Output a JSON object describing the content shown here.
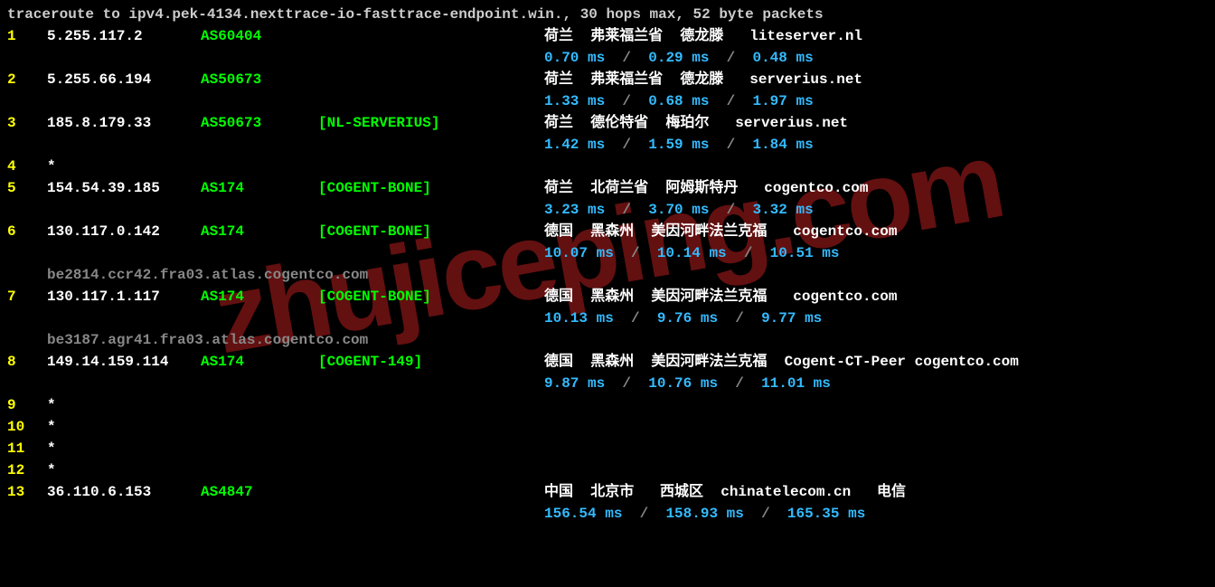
{
  "header": "traceroute to ipv4.pek-4134.nexttrace-io-fasttrace-endpoint.win., 30 hops max, 52 byte packets",
  "watermark": "zhujiceping.com",
  "hops": [
    {
      "num": "1",
      "ip": "5.255.117.2",
      "as": "AS60404",
      "tag": "",
      "loc": "荷兰  弗莱福兰省  德龙滕   liteserver.nl",
      "lat": [
        "0.70 ms",
        "0.29 ms",
        "0.48 ms"
      ]
    },
    {
      "num": "2",
      "ip": "5.255.66.194",
      "as": "AS50673",
      "tag": "",
      "loc": "荷兰  弗莱福兰省  德龙滕   serverius.net",
      "lat": [
        "1.33 ms",
        "0.68 ms",
        "1.97 ms"
      ]
    },
    {
      "num": "3",
      "ip": "185.8.179.33",
      "as": "AS50673",
      "tag": "[NL-SERVERIUS]",
      "loc": "荷兰  德伦特省  梅珀尔   serverius.net",
      "lat": [
        "1.42 ms",
        "1.59 ms",
        "1.84 ms"
      ]
    },
    {
      "num": "4",
      "ip": "*",
      "as": "",
      "tag": "",
      "loc": "",
      "lat": []
    },
    {
      "num": "5",
      "ip": "154.54.39.185",
      "as": "AS174",
      "tag": "[COGENT-BONE]",
      "loc": "荷兰  北荷兰省  阿姆斯特丹   cogentco.com",
      "lat": [
        "3.23 ms",
        "3.70 ms",
        "3.32 ms"
      ]
    },
    {
      "num": "6",
      "ip": "130.117.0.142",
      "as": "AS174",
      "tag": "[COGENT-BONE]",
      "loc": "德国  黑森州  美因河畔法兰克福   cogentco.com",
      "lat": [
        "10.07 ms",
        "10.14 ms",
        "10.51 ms"
      ],
      "rdns": "be2814.ccr42.fra03.atlas.cogentco.com"
    },
    {
      "num": "7",
      "ip": "130.117.1.117",
      "as": "AS174",
      "tag": "[COGENT-BONE]",
      "loc": "德国  黑森州  美因河畔法兰克福   cogentco.com",
      "lat": [
        "10.13 ms",
        "9.76 ms",
        "9.77 ms"
      ],
      "rdns": "be3187.agr41.fra03.atlas.cogentco.com"
    },
    {
      "num": "8",
      "ip": "149.14.159.114",
      "as": "AS174",
      "tag": "[COGENT-149]",
      "loc": "德国  黑森州  美因河畔法兰克福  Cogent-CT-Peer cogentco.com",
      "lat": [
        "9.87 ms",
        "10.76 ms",
        "11.01 ms"
      ]
    },
    {
      "num": "9",
      "ip": "*",
      "as": "",
      "tag": "",
      "loc": "",
      "lat": []
    },
    {
      "num": "10",
      "ip": "*",
      "as": "",
      "tag": "",
      "loc": "",
      "lat": []
    },
    {
      "num": "11",
      "ip": "*",
      "as": "",
      "tag": "",
      "loc": "",
      "lat": []
    },
    {
      "num": "12",
      "ip": "*",
      "as": "",
      "tag": "",
      "loc": "",
      "lat": []
    },
    {
      "num": "13",
      "ip": "36.110.6.153",
      "as": "AS4847",
      "tag": "",
      "loc": "中国  北京市   西城区  chinatelecom.cn   电信",
      "lat": [
        "156.54 ms",
        "158.93 ms",
        "165.35 ms"
      ]
    }
  ]
}
